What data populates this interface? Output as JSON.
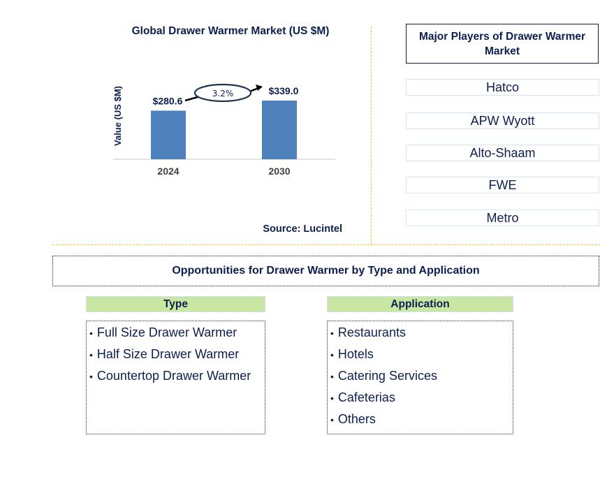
{
  "chart_data": {
    "type": "bar",
    "title": "Global Drawer Warmer Market (US $M)",
    "xlabel": "",
    "ylabel": "Value (US $M)",
    "categories": [
      "2024",
      "2030"
    ],
    "values": [
      280.6,
      339.0
    ],
    "data_labels": [
      "$280.6",
      "$339.0"
    ],
    "cagr_annotation": "3.2%",
    "bar_color": "#4f81bd",
    "ylim": [
      0,
      400
    ],
    "grid": false,
    "legend": "none",
    "source": "Source: Lucintel"
  },
  "players": {
    "title": "Major Players of Drawer Warmer Market",
    "items": [
      "Hatco",
      "APW Wyott",
      "Alto-Shaam",
      "FWE",
      "Metro"
    ]
  },
  "opportunities": {
    "title": "Opportunities for Drawer Warmer by Type and Application",
    "type": {
      "header": "Type",
      "items": [
        "Full Size Drawer Warmer",
        "Half Size Drawer Warmer",
        "Countertop Drawer Warmer"
      ]
    },
    "application": {
      "header": "Application",
      "items": [
        "Restaurants",
        "Hotels",
        "Catering Services",
        "Cafeterias",
        "Others"
      ]
    }
  },
  "bullet": "•",
  "colors": {
    "text_navy": "#0d1f4f",
    "bar_blue": "#4f81bd",
    "header_green": "#c9e6a3",
    "divider_gold": "#f5c518"
  }
}
